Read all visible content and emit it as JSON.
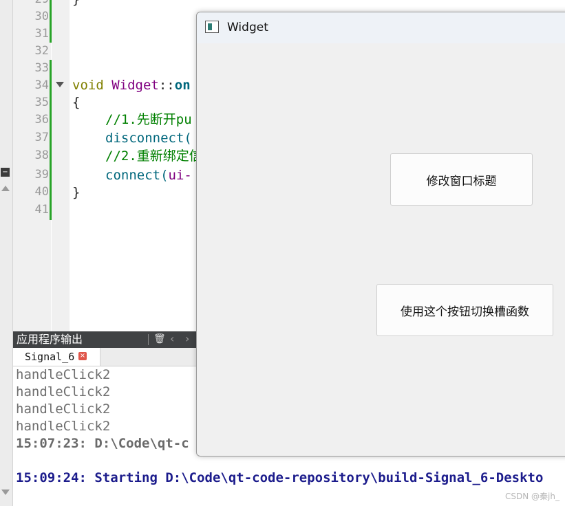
{
  "editor": {
    "line_numbers": [
      "29",
      "30",
      "31",
      "32",
      "33",
      "34",
      "35",
      "36",
      "37",
      "38",
      "39",
      "40",
      "41"
    ],
    "code": {
      "line29": "}",
      "line34_keyword": "void",
      "line34_class": "Widget",
      "line34_sep": "::",
      "line34_func": "on",
      "line35": "{",
      "line36_comment": "//1.先断开pu",
      "line37_call": "disconnect(",
      "line38_comment": "//2.重新绑定信",
      "line39_call": "connect(",
      "line39_arg": "ui-",
      "line40": "}"
    }
  },
  "output_panel": {
    "title": "应用程序输出",
    "clear_icon": "🗑",
    "prev_icon": "‹",
    "next_icon": "›",
    "tab_label": "Signal_6",
    "tab_close_icon": "×",
    "lines": [
      "handleClick2",
      "handleClick2",
      "handleClick2",
      "handleClick2",
      "15:07:23: D:\\Code\\qt-c",
      "",
      "15:09:24: Starting D:\\Code\\qt-code-repository\\build-Signal_6-Deskto"
    ]
  },
  "widget": {
    "title": "Widget",
    "rename_button": "修改窗口标题",
    "switch_button": "使用这个按钮切换槽函数"
  },
  "watermark": "CSDN @秦jh_"
}
